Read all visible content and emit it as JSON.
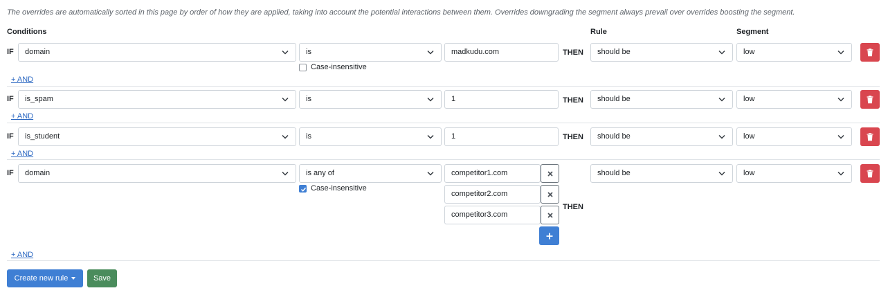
{
  "note": "The overrides are automatically sorted in this page by order of how they are applied, taking into account the potential interactions between them. Overrides downgrading the segment always prevail over overrides boosting the segment.",
  "headers": {
    "conditions": "Conditions",
    "rule": "Rule",
    "segment": "Segment"
  },
  "keywords": {
    "if": "IF",
    "then": "THEN"
  },
  "and_label": "+ AND",
  "case_insensitive_label": "Case-insensitive",
  "rules": [
    {
      "field": "domain",
      "operator": "is",
      "value": "madkudu.com",
      "case_insensitive": false,
      "rule": "should be",
      "segment": "low"
    },
    {
      "field": "is_spam",
      "operator": "is",
      "value": "1",
      "rule": "should be",
      "segment": "low"
    },
    {
      "field": "is_student",
      "operator": "is",
      "value": "1",
      "rule": "should be",
      "segment": "low"
    },
    {
      "field": "domain",
      "operator": "is any of",
      "values": [
        "competitor1.com",
        "competitor2.com",
        "competitor3.com"
      ],
      "case_insensitive": true,
      "rule": "should be",
      "segment": "low"
    }
  ],
  "buttons": {
    "create": "Create new rule",
    "save": "Save"
  },
  "colors": {
    "primary": "#3f7fd4",
    "danger": "#d9464f",
    "success": "#4a8c5c",
    "link": "#2c68c2"
  },
  "icons": {
    "delete": "trash-icon",
    "remove_value": "close-icon",
    "add_value": "plus-icon",
    "dropdown": "chevron-down-icon"
  }
}
